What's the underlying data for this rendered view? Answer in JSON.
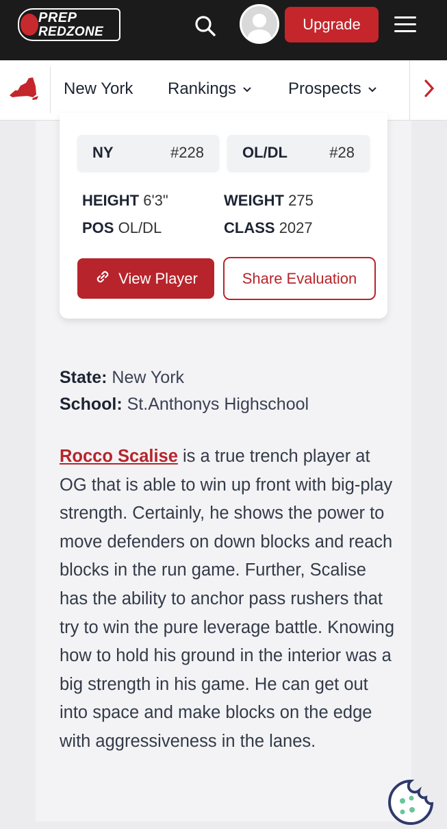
{
  "header": {
    "logo_line1": "PREP",
    "logo_line2": "REDZONE",
    "upgrade_label": "Upgrade",
    "icons": [
      "search-icon",
      "avatar",
      "hamburger-menu-icon"
    ]
  },
  "nav": {
    "state": "New York",
    "rankings": "Rankings",
    "prospects": "Prospects",
    "next_icon": "chevron-right-icon"
  },
  "card": {
    "state_rank_label": "NY",
    "state_rank_value": "#228",
    "position_rank_label": "OL/DL",
    "position_rank_value": "#28",
    "height_label": "HEIGHT",
    "height_value": "6'3\"",
    "weight_label": "WEIGHT",
    "weight_value": "275",
    "pos_label": "POS",
    "pos_value": "OL/DL",
    "class_label": "CLASS",
    "class_value": "2027",
    "view_player": "View Player",
    "share_evaluation": "Share Evaluation"
  },
  "details": {
    "state_label": "State:",
    "state_value": "New York",
    "school_label": "School:",
    "school_value": "St.Anthonys Highschool"
  },
  "evaluation": {
    "player_link": "Rocco Scalise",
    "text": " is a true trench player at OG that is able to win up front with big-play strength. Certainly, he shows the power to move defenders on down blocks and reach blocks in the run game. Further, Scalise has the ability to anchor pass rushers that try to win the pure leverage battle. Knowing how to hold his ground in the interior was a big strength in his game. He can get out into space and make blocks on the edge with aggressiveness in the lanes."
  },
  "colors": {
    "brand_red": "#c4262b",
    "topbar": "#1b1b1b"
  }
}
